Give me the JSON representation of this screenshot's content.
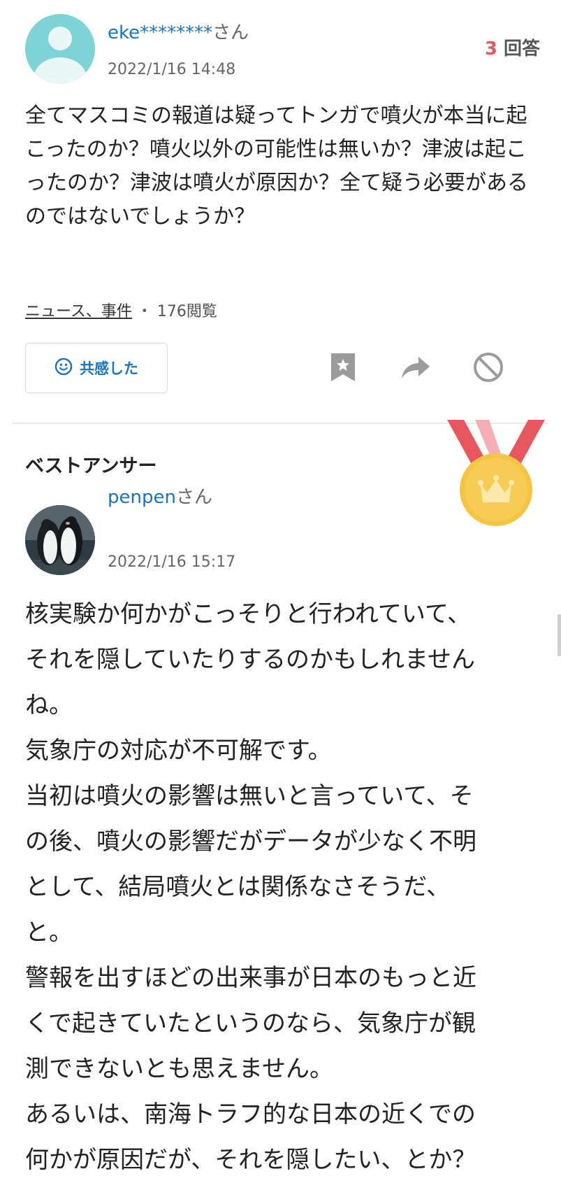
{
  "question": {
    "user_name": "eke********",
    "user_suffix": "さん",
    "date": "2022/1/16 14:48",
    "answer_count": "3",
    "answer_label": "回答",
    "body": "全てマスコミの報道は疑ってトンガで噴火が本当に起こったのか？噴火以外の可能性は無いか？津波は起こったのか？津波は噴火が原因か？全て疑う必要があるのではないでしょうか？",
    "category": "ニュース、事件",
    "separator": "・",
    "views": "176閲覧",
    "kyokan_label": "共感した"
  },
  "best_answer": {
    "section_title": "ベストアンサー",
    "user_name": "penpen",
    "user_suffix": "さん",
    "date": "2022/1/16 15:17",
    "body_lines": [
      "核実験か何かがこっそりと行われていて、",
      "それを隠していたりするのかもしれません",
      "ね。",
      "気象庁の対応が不可解です。",
      "当初は噴火の影響は無いと言っていて、そ",
      "の後、噴火の影響だがデータが少なく不明",
      "として、結局噴火とは関係なさそうだ、",
      "と。",
      "警報を出すほどの出来事が日本のもっと近",
      "くで起きていたというのなら、気象庁が観",
      "測できないとも思えません。",
      "あるいは、南海トラフ的な日本の近くでの",
      "何かが原因だが、それを隠したい、とか？"
    ]
  },
  "colors": {
    "link_blue": "#1a75bb",
    "count_red": "#e95464",
    "medal_gold": "#f5c542",
    "ribbon_red": "#e8575f"
  },
  "icons": {
    "smile": "smile-icon",
    "bookmark": "bookmark-icon",
    "share": "share-icon",
    "block": "block-icon",
    "medal": "medal-crown-icon"
  }
}
